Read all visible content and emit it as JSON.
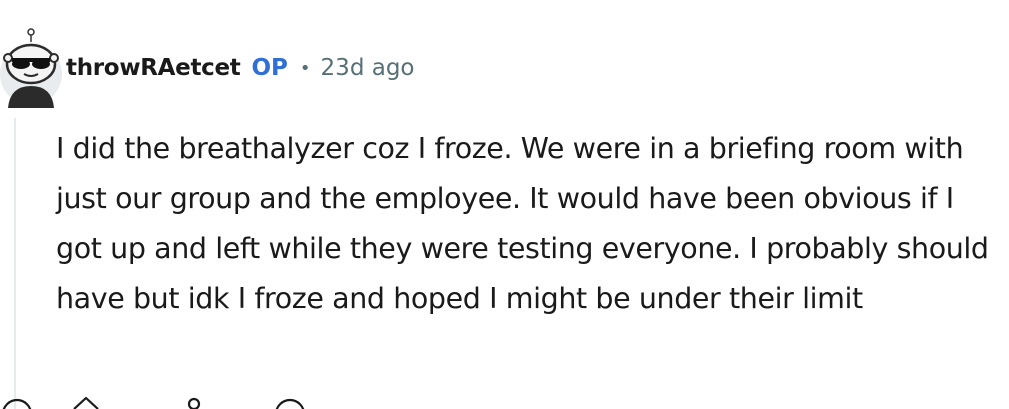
{
  "comment": {
    "author": "throwRAetcet",
    "badge": "OP",
    "separator": "•",
    "timestamp": "23d ago",
    "body": "I did the breathalyzer coz I froze. We were in a briefing room with just our group and the employee. It would have been obvious if I got up and left while they were testing everyone. I probably should have but idk I froze and hoped I might be under their limit"
  },
  "icons": {
    "avatar": "snoo-avatar-sunglasses",
    "collapse": "collapse-thread-icon",
    "upvote": "upvote-arrow-icon",
    "award": "award-icon",
    "reply": "reply-bubble-icon"
  },
  "colors": {
    "text": "#1a1a1b",
    "meta": "#576f76",
    "op": "#2f6fd6",
    "thread_line": "#e5ebee"
  }
}
